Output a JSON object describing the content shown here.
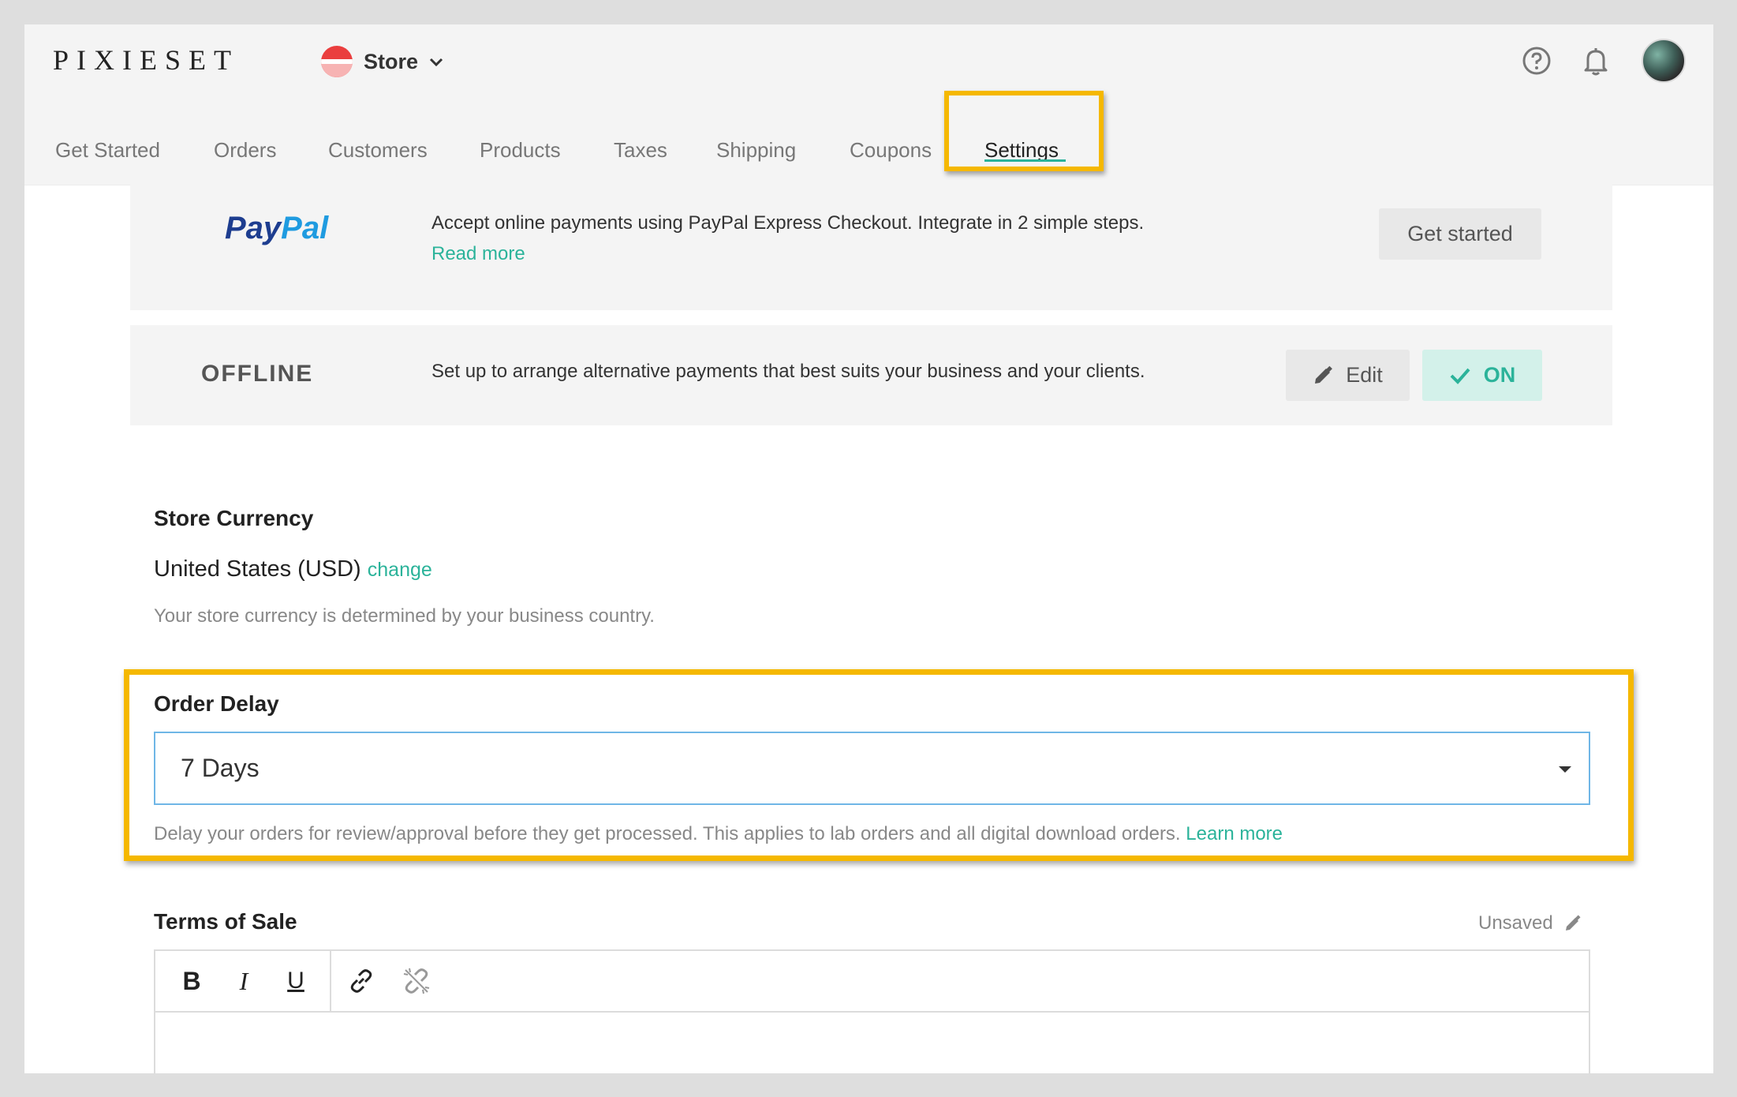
{
  "header": {
    "brand": "PIXIESET",
    "store_switch": "Store",
    "icons": [
      "help-icon",
      "bell-icon",
      "avatar"
    ]
  },
  "tabs": [
    {
      "label": "Get Started",
      "active": false
    },
    {
      "label": "Orders",
      "active": false
    },
    {
      "label": "Customers",
      "active": false
    },
    {
      "label": "Products",
      "active": false
    },
    {
      "label": "Taxes",
      "active": false
    },
    {
      "label": "Shipping",
      "active": false
    },
    {
      "label": "Coupons",
      "active": false
    },
    {
      "label": "Settings",
      "active": true
    }
  ],
  "payments": {
    "paypal": {
      "logo_part1": "Pay",
      "logo_part2": "Pal",
      "description": "Accept online payments using PayPal Express Checkout. Integrate in 2 simple steps.",
      "read_more": "Read more",
      "button": "Get started"
    },
    "offline": {
      "title": "OFFLINE",
      "description": "Set up to arrange alternative payments that best suits your business and your clients.",
      "edit_button": "Edit",
      "toggle_label": "ON"
    }
  },
  "store_currency": {
    "heading": "Store Currency",
    "value": "United States (USD)",
    "change_link": "change",
    "hint": "Your store currency is determined by your business country."
  },
  "order_delay": {
    "heading": "Order Delay",
    "selected": "7 Days",
    "hint": "Delay your orders for review/approval before they get processed. This applies to lab orders and all digital download orders.",
    "learn_more": "Learn more"
  },
  "terms_of_sale": {
    "heading": "Terms of Sale",
    "status": "Unsaved",
    "toolbar": {
      "bold": "B",
      "italic": "I",
      "underline": "U"
    }
  },
  "colors": {
    "accent": "#2bb39a",
    "highlight": "#f5b800",
    "paypal_dark": "#1d3d8f",
    "paypal_light": "#1f9be0"
  }
}
